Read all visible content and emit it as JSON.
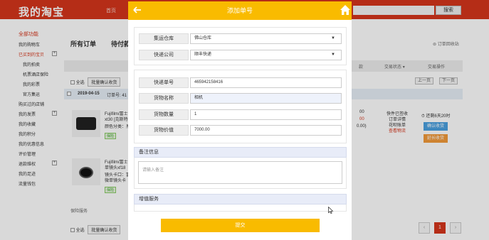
{
  "header": {
    "logo": "我的淘宝",
    "home": "首页",
    "search_button": "搜索"
  },
  "sidebar": {
    "section_all": "全部功能",
    "items": [
      {
        "label": "我的购物车",
        "sub": false,
        "active": false,
        "expand": false
      },
      {
        "label": "已买到的宝贝",
        "sub": false,
        "active": true,
        "expand": true
      },
      {
        "label": "我的拍卖",
        "sub": true,
        "active": false,
        "expand": false
      },
      {
        "label": "机票酒店保险",
        "sub": true,
        "active": false,
        "expand": false
      },
      {
        "label": "我的彩票",
        "sub": true,
        "active": false,
        "expand": false
      },
      {
        "label": "官方集运",
        "sub": true,
        "active": false,
        "expand": false
      },
      {
        "label": "购买过的店铺",
        "sub": false,
        "active": false,
        "expand": false
      },
      {
        "label": "我的发票",
        "sub": false,
        "active": false,
        "expand": true
      },
      {
        "label": "我的收藏",
        "sub": false,
        "active": false,
        "expand": false
      },
      {
        "label": "我的积分",
        "sub": false,
        "active": false,
        "expand": false
      },
      {
        "label": "我的优惠信息",
        "sub": false,
        "active": false,
        "expand": false
      },
      {
        "label": "评价管理",
        "sub": false,
        "active": false,
        "expand": false
      },
      {
        "label": "退款维权",
        "sub": false,
        "active": false,
        "expand": true
      },
      {
        "label": "我的足迹",
        "sub": false,
        "active": false,
        "expand": false
      },
      {
        "label": "流量钱包",
        "sub": false,
        "active": false,
        "expand": false
      }
    ]
  },
  "orders_page": {
    "tab_all": "所有订单",
    "tab_pending": "待付款",
    "recycle": "订单回收站",
    "col_status": "交易状态",
    "col_action": "交易操作",
    "col_partial": "款",
    "select_all": "全选",
    "batch_confirm": "批量确认收货",
    "prev": "上一页",
    "next": "下一页",
    "order_date": "2019-04-15",
    "order_no_label": "订单号: 41",
    "product1": {
      "title": "Fujifilm/富士 xt30 [克斯特",
      "sub": "颜色分类：黑",
      "tag": "保险",
      "price1": "00",
      "price2": "00",
      "price3": "0.00)"
    },
    "product2": {
      "title": "Fujifilm/富士 单镜头xf18",
      "sub": "镜头卡口：富 微单镜头卡",
      "tag": "保险"
    },
    "status_lines": [
      "快件已签收",
      "订单详情",
      "花呗账单",
      "查看物流"
    ],
    "remaining": "还剩6天20时",
    "confirm_btn": "确认收货",
    "extend_btn": "延长收货",
    "insurance_service": "保险服务",
    "page_current": "1"
  },
  "modal": {
    "title": "添加单号",
    "warehouse_label": "集运仓库",
    "warehouse_value": "佛山仓库",
    "courier_label": "快递公司",
    "courier_value": "顺丰快递",
    "tracking_label": "快递单号",
    "tracking_value": "465942158416",
    "goods_name_label": "货物名称",
    "goods_name_value": "相机",
    "goods_qty_label": "货物数量",
    "goods_qty_value": "1",
    "goods_value_label": "货物价值",
    "goods_value_value": "7000.00",
    "remark_header": "备注信息",
    "remark_placeholder": "请输入备注",
    "value_added_header": "增值服务",
    "submit_label": "提交"
  },
  "colors": {
    "brand_red": "#d5361c",
    "modal_yellow": "#f9bb00",
    "accent_blue": "#4aa0e0",
    "accent_orange": "#f39a3a"
  }
}
